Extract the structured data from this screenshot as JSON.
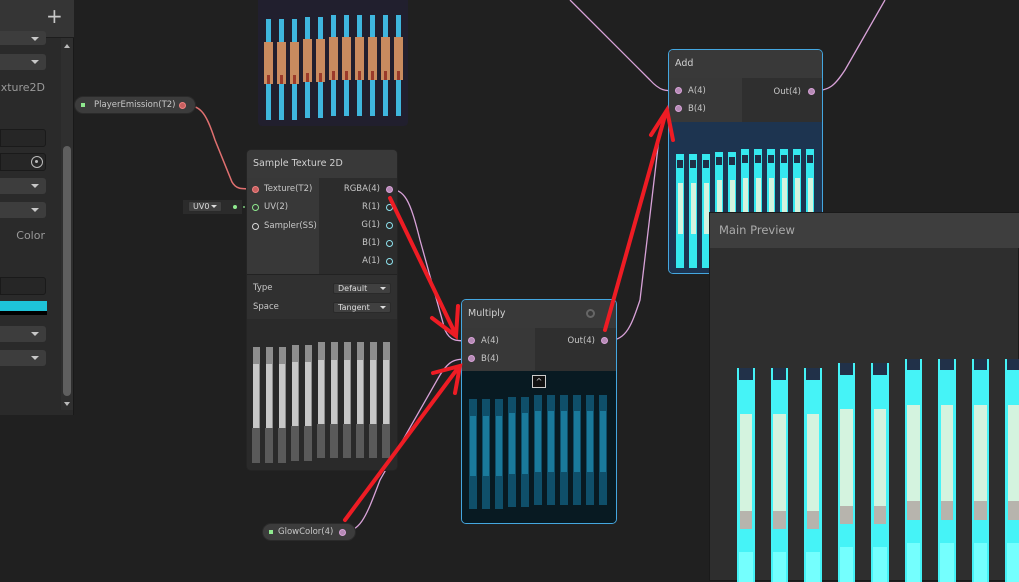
{
  "left_panel": {
    "add_label": "+",
    "type_text": "xture2D",
    "color_text": "Color",
    "swatch_color": "#1ec3d8"
  },
  "properties": {
    "player_emission": "PlayerEmission(T2)",
    "glow_color": "GlowColor(4)",
    "uv_select": "UV0"
  },
  "sample_texture": {
    "title": "Sample Texture 2D",
    "inputs": [
      "Texture(T2)",
      "UV(2)",
      "Sampler(SS)"
    ],
    "outputs": [
      "RGBA(4)",
      "R(1)",
      "G(1)",
      "B(1)",
      "A(1)"
    ],
    "type_label": "Type",
    "type_value": "Default",
    "space_label": "Space",
    "space_value": "Tangent"
  },
  "multiply": {
    "title": "Multiply",
    "inputs": [
      "A(4)",
      "B(4)"
    ],
    "output": "Out(4)"
  },
  "add": {
    "title": "Add",
    "inputs": [
      "A(4)",
      "B(4)"
    ],
    "output": "Out(4)"
  },
  "main_preview": {
    "title": "Main Preview"
  },
  "colors": {
    "selection": "#44a7e0",
    "annotation_arrow": "#ee1c24",
    "texture_wire": "#f08080",
    "vector_wire": "#d8a2d8"
  }
}
